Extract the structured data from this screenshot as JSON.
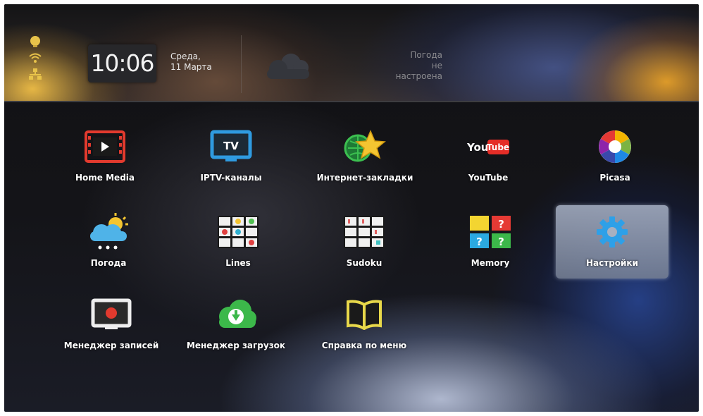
{
  "status": {
    "icons": [
      "bulb-icon",
      "wifi-icon",
      "network-icon"
    ]
  },
  "clock": {
    "time": "10:06",
    "day": "Среда,",
    "date": "11 Марта"
  },
  "weather": {
    "icon": "cloud-icon",
    "line1": "Погода",
    "line2": "не",
    "line3": "настроена"
  },
  "menu": {
    "selected": "Настройки",
    "items": [
      {
        "label": "Home Media",
        "icon": "home-media-icon"
      },
      {
        "label": "IPTV-каналы",
        "icon": "tv-icon"
      },
      {
        "label": "Интернет-закладки",
        "icon": "bookmarks-icon"
      },
      {
        "label": "YouTube",
        "icon": "youtube-icon"
      },
      {
        "label": "Picasa",
        "icon": "picasa-icon"
      },
      {
        "label": "Погода",
        "icon": "weather-icon"
      },
      {
        "label": "Lines",
        "icon": "lines-icon"
      },
      {
        "label": "Sudoku",
        "icon": "sudoku-icon"
      },
      {
        "label": "Memory",
        "icon": "memory-icon"
      },
      {
        "label": "Настройки",
        "icon": "gear-icon"
      },
      {
        "label": "Менеджер записей",
        "icon": "record-icon"
      },
      {
        "label": "Менеджер загрузок",
        "icon": "download-icon"
      },
      {
        "label": "Справка по меню",
        "icon": "book-icon"
      }
    ],
    "icon_texts": {
      "tv": "TV",
      "youtube_you": "You",
      "youtube_tube": "Tube",
      "memory_q": "?"
    }
  },
  "colors": {
    "accent_selected": "#9aa4b8",
    "home_media_red": "#e23a2e",
    "tv_blue": "#2f9be0",
    "youtube_red": "#e52d27",
    "gear_blue": "#2ea0e8",
    "download_green": "#3cb84a",
    "book_yellow": "#e8d84a"
  }
}
